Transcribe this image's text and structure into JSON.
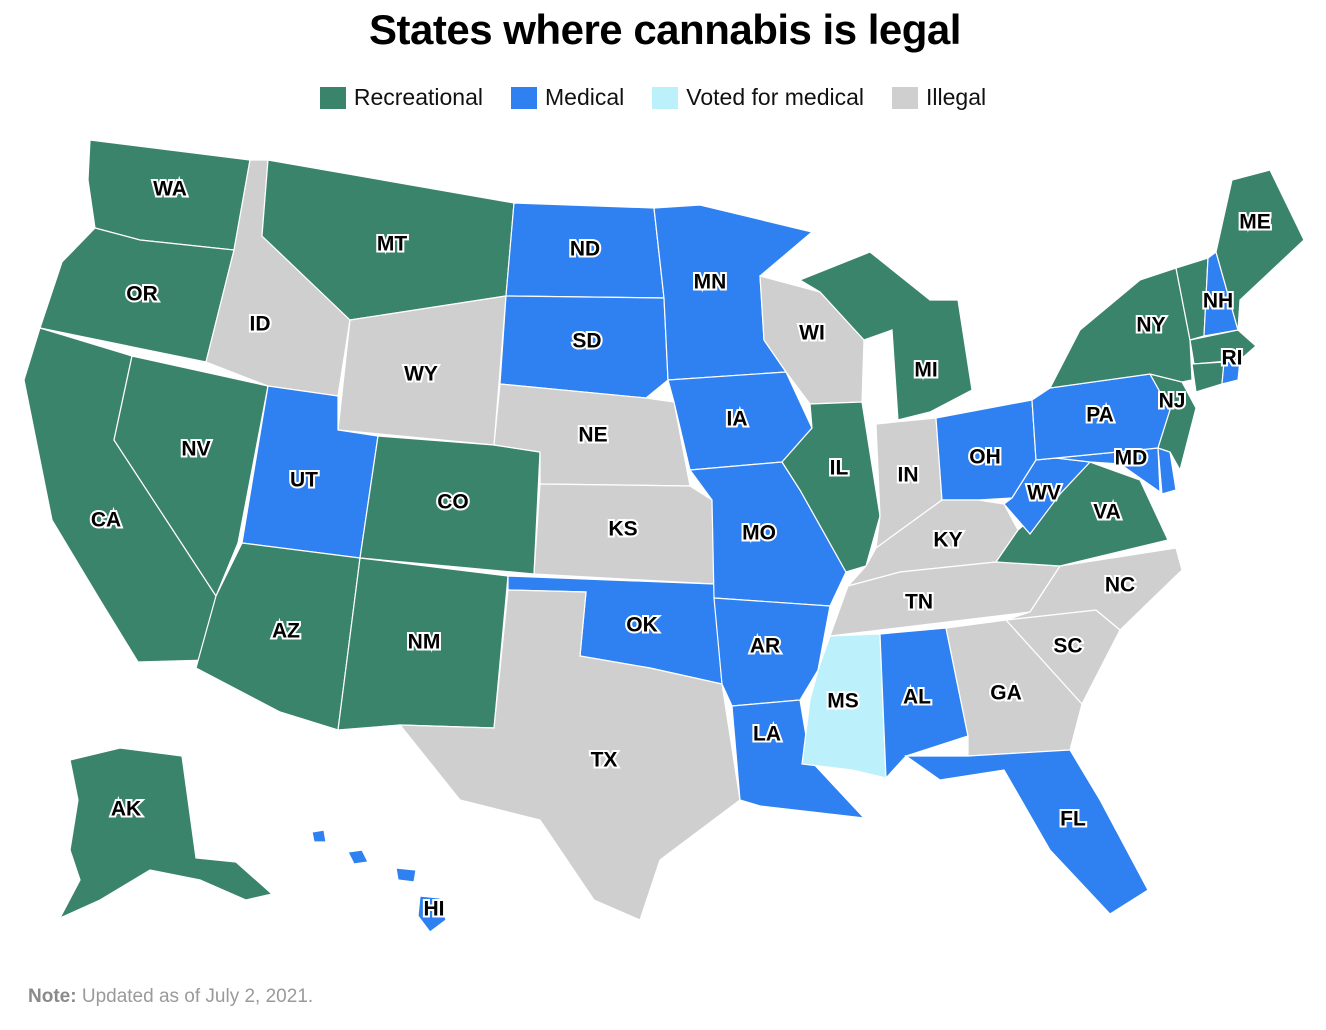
{
  "title": "States where cannabis is legal",
  "legend": [
    {
      "label": "Recreational",
      "color": "#3b846c"
    },
    {
      "label": "Medical",
      "color": "#2f80f0"
    },
    {
      "label": "Voted for medical",
      "color": "#bcf0fb"
    },
    {
      "label": "Illegal",
      "color": "#cfcfcf"
    }
  ],
  "note": {
    "label": "Note:",
    "text": "Updated as of July 2, 2021."
  },
  "states": {
    "WA": "Recreational",
    "OR": "Recreational",
    "CA": "Recreational",
    "NV": "Recreational",
    "ID": "Illegal",
    "MT": "Recreational",
    "WY": "Illegal",
    "UT": "Medical",
    "AZ": "Recreational",
    "CO": "Recreational",
    "NM": "Recreational",
    "ND": "Medical",
    "SD": "Medical",
    "NE": "Illegal",
    "KS": "Illegal",
    "OK": "Medical",
    "TX": "Illegal",
    "MN": "Medical",
    "IA": "Medical",
    "MO": "Medical",
    "AR": "Medical",
    "LA": "Medical",
    "WI": "Illegal",
    "IL": "Recreational",
    "MI": "Recreational",
    "IN": "Illegal",
    "OH": "Medical",
    "KY": "Illegal",
    "TN": "Illegal",
    "MS": "Voted for medical",
    "AL": "Medical",
    "GA": "Illegal",
    "FL": "Medical",
    "SC": "Illegal",
    "NC": "Illegal",
    "VA": "Recreational",
    "WV": "Medical",
    "PA": "Medical",
    "NY": "Recreational",
    "VT": "Recreational",
    "NH": "Medical",
    "ME": "Recreational",
    "MA": "Recreational",
    "RI": "Medical",
    "CT": "Recreational",
    "NJ": "Recreational",
    "DE": "Medical",
    "MD": "Medical",
    "AK": "Recreational",
    "HI": "Medical"
  }
}
